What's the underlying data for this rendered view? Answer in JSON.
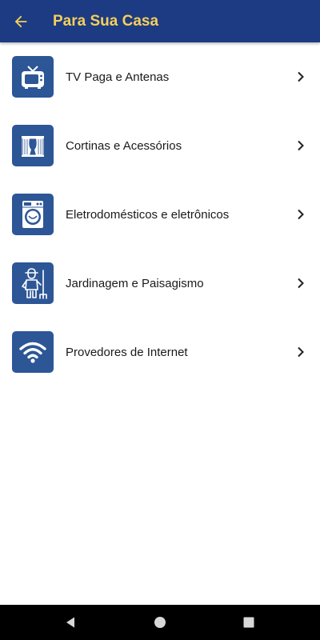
{
  "appbar": {
    "title": "Para Sua Casa",
    "back_icon": "arrow-back-icon",
    "background": "#1c3b82",
    "title_color": "#f5cf5b"
  },
  "categories": [
    {
      "label": "TV Paga e Antenas",
      "icon": "tv-icon"
    },
    {
      "label": "Cortinas e Acessórios",
      "icon": "curtain-icon"
    },
    {
      "label": "Eletrodomésticos e eletrônicos",
      "icon": "washing-machine-icon"
    },
    {
      "label": "Jardinagem e Paisagismo",
      "icon": "gardener-icon"
    },
    {
      "label": "Provedores de Internet",
      "icon": "wifi-icon"
    }
  ],
  "tile_color": "#2d5696",
  "navbar": {
    "buttons": [
      "back-triangle-icon",
      "home-circle-icon",
      "recents-square-icon"
    ]
  }
}
